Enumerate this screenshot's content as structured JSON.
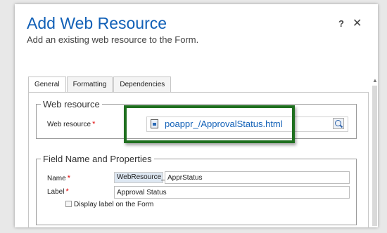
{
  "dialog": {
    "title": "Add Web Resource",
    "subtitle": "Add an existing web resource to the Form.",
    "help_label": "?",
    "close_label": "✕"
  },
  "tabs": [
    {
      "label": "General",
      "active": true
    },
    {
      "label": "Formatting",
      "active": false
    },
    {
      "label": "Dependencies",
      "active": false
    }
  ],
  "web_resource_section": {
    "legend": "Web resource",
    "field_label": "Web resource",
    "required_marker": "*",
    "value": "poappr_/ApprovalStatus.html",
    "value_icon": "document-icon",
    "lookup_icon": "lookup-search-icon"
  },
  "field_section": {
    "legend": "Field Name and Properties",
    "name_label": "Name",
    "name_required": "*",
    "name_prefix": "WebResource_",
    "name_value": "ApprStatus",
    "label_label": "Label",
    "label_required": "*",
    "label_value": "Approval Status",
    "display_checkbox_label": "Display label on the Form",
    "display_checked": false
  },
  "colors": {
    "title": "#1160b7",
    "highlight_border": "#1f6f1f",
    "required": "#e00000"
  }
}
